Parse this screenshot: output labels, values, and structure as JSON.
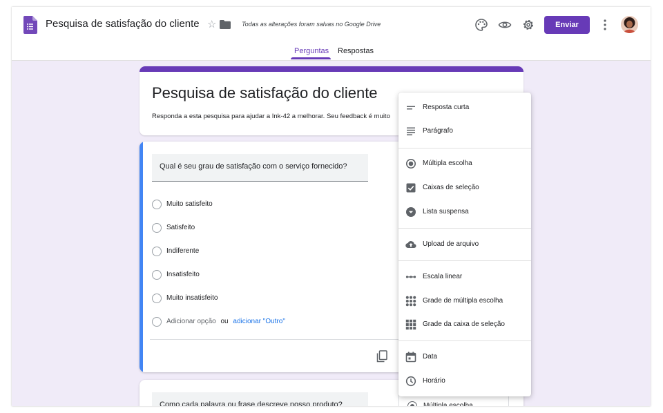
{
  "header": {
    "doc_title": "Pesquisa de satisfação do cliente",
    "save_status": "Todas as alterações foram salvas no Google Drive",
    "send_label": "Enviar",
    "icons": [
      "palette-icon",
      "preview-eye-icon",
      "settings-gear-icon",
      "more-vert-icon"
    ]
  },
  "tabs": [
    {
      "label": "Perguntas",
      "active": true
    },
    {
      "label": "Respostas",
      "active": false
    }
  ],
  "form": {
    "title": "Pesquisa de satisfação do cliente",
    "description": "Responda a esta pesquisa para ajudar a Ink-42 a melhorar. Seu feedback é muito"
  },
  "question1": {
    "text": "Qual é seu grau de satisfação com o serviço fornecido?",
    "options": [
      "Muito satisfeito",
      "Satisfeito",
      "Indiferente",
      "Insatisfeito",
      "Muito insatisfeito"
    ],
    "add_option": "Adicionar opção",
    "or": "ou",
    "add_other": "adicionar \"Outro\""
  },
  "question2": {
    "text": "Como cada palavra ou frase descreve nosso produto?",
    "type": "Múltipla escolha"
  },
  "menu": {
    "items": [
      {
        "label": "Resposta curta",
        "icon": "short-text-icon"
      },
      {
        "label": "Parágrafo",
        "icon": "paragraph-icon"
      },
      {
        "label": "Múltipla escolha",
        "icon": "radio-button-icon"
      },
      {
        "label": "Caixas de seleção",
        "icon": "checkbox-icon"
      },
      {
        "label": "Lista suspensa",
        "icon": "dropdown-icon"
      },
      {
        "label": "Upload de arquivo",
        "icon": "cloud-upload-icon"
      },
      {
        "label": "Escala linear",
        "icon": "linear-scale-icon"
      },
      {
        "label": "Grade de múltipla escolha",
        "icon": "radio-grid-icon"
      },
      {
        "label": "Grade da caixa de seleção",
        "icon": "checkbox-grid-icon"
      },
      {
        "label": "Data",
        "icon": "calendar-icon"
      },
      {
        "label": "Horário",
        "icon": "clock-icon"
      }
    ]
  },
  "colors": {
    "brand": "#673ab7",
    "background": "#f0ebf8",
    "focus_bar": "#4285f4",
    "link": "#1a73e8"
  }
}
